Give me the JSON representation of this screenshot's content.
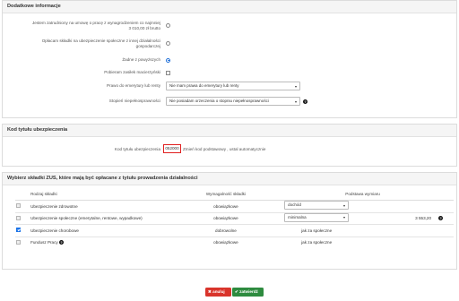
{
  "dodatkowe": {
    "title": "Dodatkowe informacje",
    "q1": {
      "label_line1": "Jestem zatrudniony na umowę o pracę z wynagrodzeniem co najmniej",
      "label_line2": "3 010,00 zł brutto"
    },
    "q2": {
      "label_line1": "Opłacam składki na ubezpieczenie społeczne z innej działalności",
      "label_line2": "gospodarczej"
    },
    "q3": {
      "label": "Żadne z powyższych"
    },
    "q4": {
      "label": "Pobieram zasiłek macierzyński"
    },
    "q5": {
      "label": "Prawo do emerytury lub renty",
      "value": "Nie mam prawa do emerytury lub renty"
    },
    "q6": {
      "label": "Stopień niepełnosprawności",
      "value": "Nie posiadam orzeczenia o stopniu niepełnosprawności"
    }
  },
  "kod": {
    "title": "Kod tytułu ubezpieczenia",
    "label": "Kod tytułu ubezpieczenia",
    "value": "052000",
    "hint": "Zmień kod podstawowy , ustal automatycznie"
  },
  "zus": {
    "title": "Wybierz składki ZUS, które mają być opłacane z tytułu prowadzenia działalności",
    "headers": {
      "rodzaj": "Rodzaj składki",
      "wymag": "Wymagalność składki",
      "podstawa": "Podstawa wymiaru"
    },
    "rows": [
      {
        "name": "Ubezpieczenie zdrowotne",
        "req": "obowiązkowe",
        "basis_select": "dochód",
        "basis_text": "",
        "amount": "",
        "checked": false,
        "disabled": true
      },
      {
        "name": "Ubezpieczenie społeczne (emerytalne, rentowe, wypadkowe)",
        "req": "obowiązkowe",
        "basis_select": "minimalna",
        "basis_text": "",
        "amount": "3 553,20",
        "checked": false,
        "disabled": true
      },
      {
        "name": "Ubezpieczenie chorobowe",
        "req": "dobrowolne",
        "basis_select": "",
        "basis_text": "jak za społeczne",
        "amount": "",
        "checked": true,
        "disabled": false
      },
      {
        "name": "Fundusz Pracy",
        "req": "obowiązkowe",
        "basis_select": "",
        "basis_text": "jak za społeczne",
        "amount": "",
        "checked": false,
        "disabled": true
      }
    ]
  },
  "buttons": {
    "cancel": "anuluj",
    "save": "zatwierdź"
  },
  "colors": {
    "highlight": "#e02020",
    "cancel": "#d9342b",
    "save": "#2e8b3f",
    "accent": "#1a73e8"
  }
}
